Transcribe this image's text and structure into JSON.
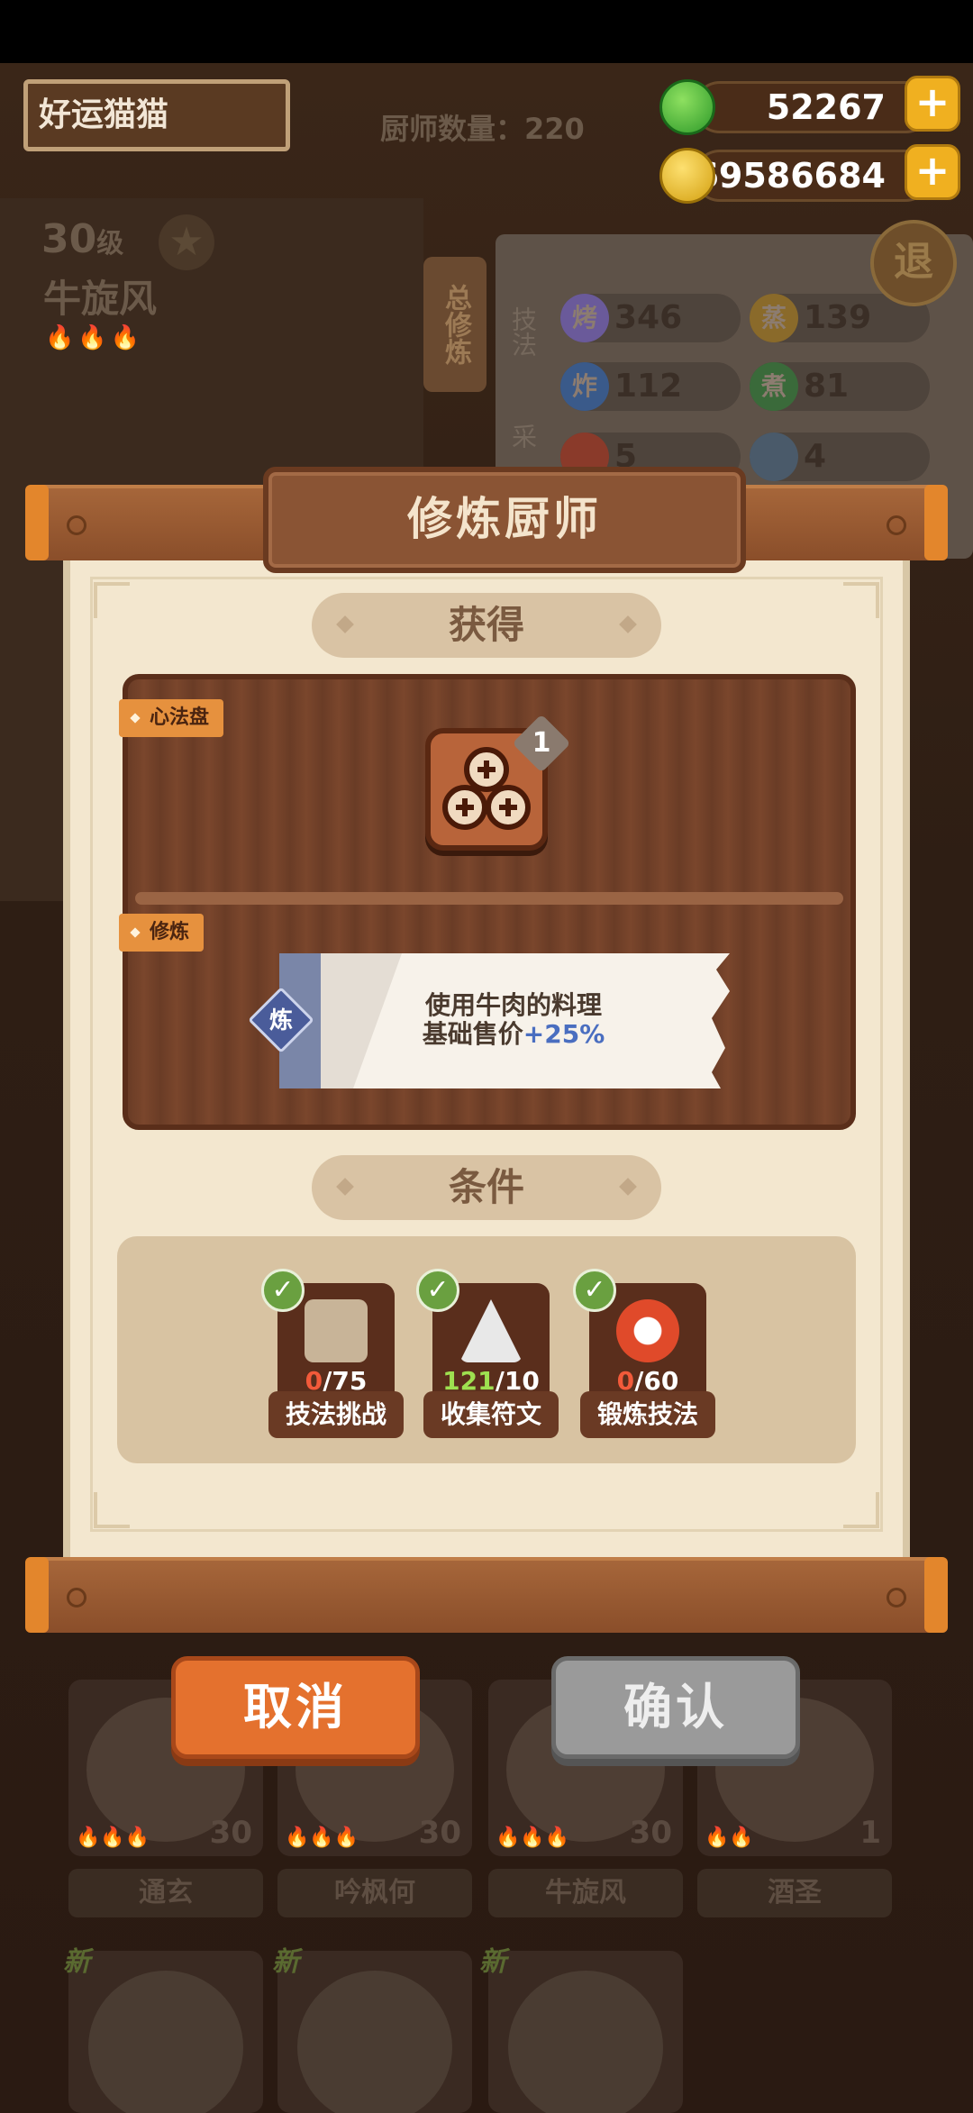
{
  "header": {
    "player_name": "好运猫猫",
    "chef_count_label": "厨师数量：220",
    "currency_jade": "52267",
    "currency_coins": "69586684",
    "plus_symbol": "+",
    "exit_label": "退"
  },
  "background_chef": {
    "level": "30",
    "level_unit": "级",
    "name": "牛旋风",
    "vertical_tab": "总修炼",
    "skills_label": "技法",
    "collect_label": "采",
    "skills": [
      {
        "icon": "烤",
        "value": "346",
        "color": "#6a5a9a"
      },
      {
        "icon": "蒸",
        "value": "139",
        "color": "#8a6a2a"
      },
      {
        "icon": "炸",
        "value": "112",
        "color": "#3a5a8a"
      },
      {
        "icon": "煮",
        "value": "81",
        "color": "#3a6a3a"
      },
      {
        "icon": "",
        "value": "5",
        "color": "#8a3a2a"
      },
      {
        "icon": "",
        "value": "4",
        "color": "#4a5a6a"
      }
    ]
  },
  "modal": {
    "title": "修炼厨师",
    "obtain_label": "获得",
    "heart_tag": "心法盘",
    "reward_count": "1",
    "cultivate_tag": "修炼",
    "effect_icon": "炼",
    "effect_line1": "使用牛肉的料理",
    "effect_line2_prefix": "基础售价",
    "effect_line2_value": "+25%",
    "conditions_label": "条件",
    "conditions": [
      {
        "current": "0",
        "total": "/75",
        "label": "技法挑战",
        "met": true
      },
      {
        "current": "121",
        "total": "/10",
        "label": "收集符文",
        "met": true
      },
      {
        "current": "0",
        "total": "/60",
        "label": "锻炼技法",
        "met": true
      }
    ],
    "check_symbol": "✓",
    "cancel_label": "取消",
    "confirm_label": "确认"
  },
  "chef_cards": [
    {
      "name": "通玄",
      "level": "30"
    },
    {
      "name": "吟枫何",
      "level": "30"
    },
    {
      "name": "牛旋风",
      "level": "30"
    },
    {
      "name": "酒圣",
      "level": "1"
    }
  ],
  "new_cards": [
    {
      "tag": "新"
    },
    {
      "tag": "新"
    },
    {
      "tag": "新"
    }
  ],
  "colors": {
    "accent_orange": "#e4712e",
    "progress_red": "#f25a3a",
    "progress_green": "#9ee050",
    "highlight_blue": "#4a6ec0"
  }
}
